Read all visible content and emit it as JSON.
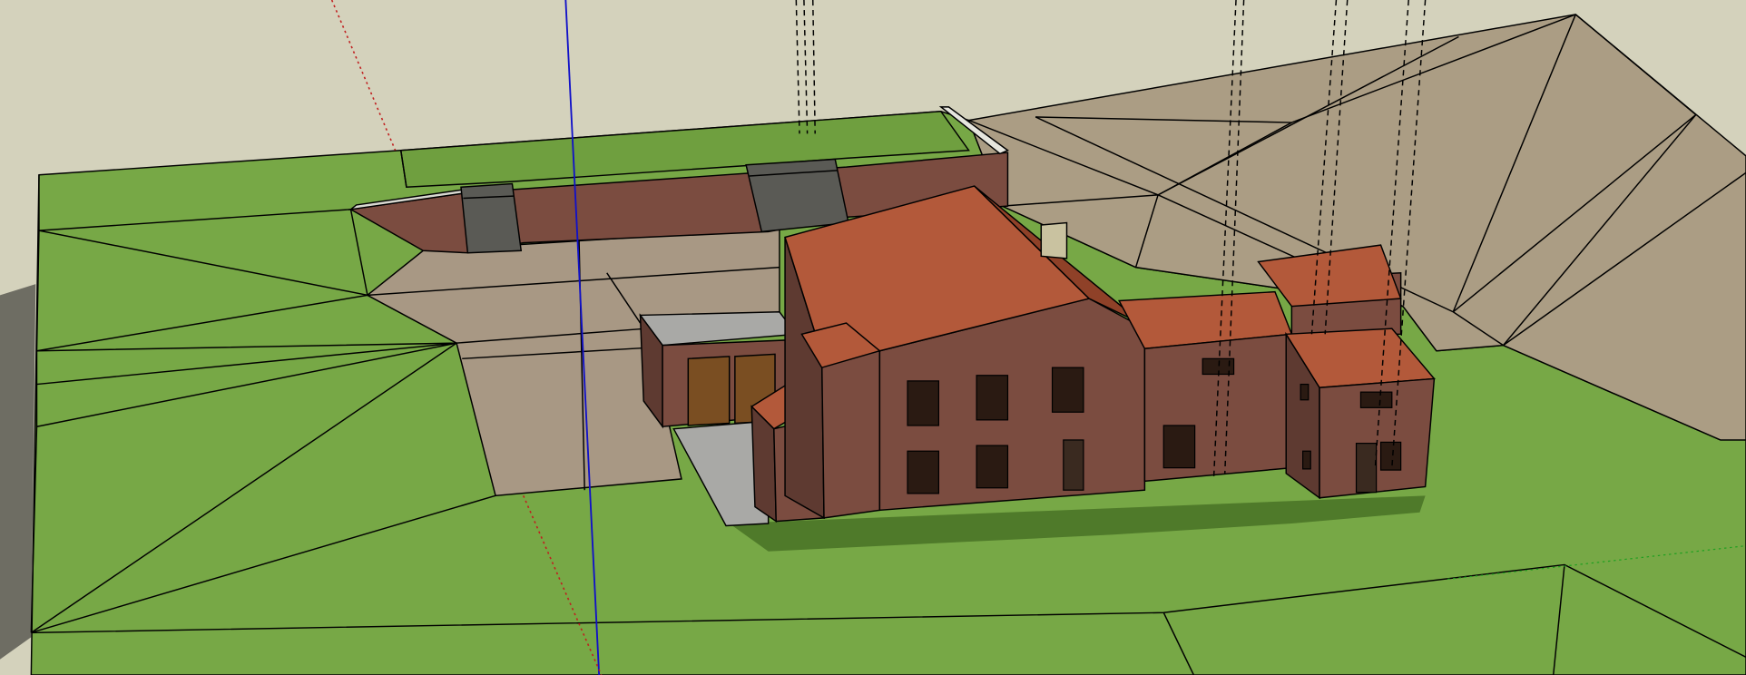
{
  "viewport": {
    "kind": "3d-model-viewport",
    "colors": {
      "background": "#d4d2bc",
      "grass": "#77a846",
      "grass_shadow": "#4f7a2a",
      "terrain": "#ab9d84",
      "pavement": "#a89884",
      "brick": "#7b4c40",
      "brick_dark": "#5e3a31",
      "roof": "#b3593a",
      "roof_dark": "#8f4128",
      "concrete": "#a9a9a6",
      "wood_door": "#7a4e22",
      "axis_blue": "#1010c8",
      "axis_red": "#c02020",
      "axis_green": "#20a020"
    }
  }
}
